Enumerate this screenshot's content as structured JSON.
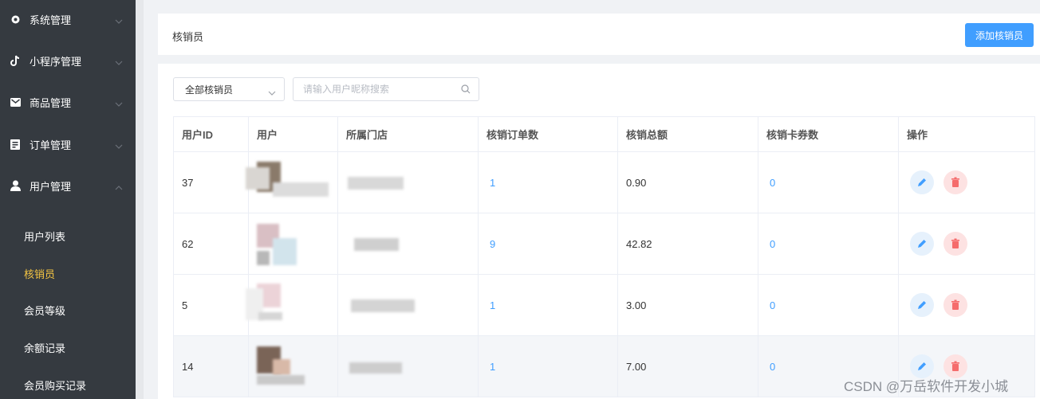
{
  "sidebar": {
    "menus": [
      {
        "label": "系统管理",
        "icon": "gear-icon"
      },
      {
        "label": "小程序管理",
        "icon": "tiktok-icon"
      },
      {
        "label": "商品管理",
        "icon": "mail-icon"
      },
      {
        "label": "订单管理",
        "icon": "order-icon"
      },
      {
        "label": "用户管理",
        "icon": "user-icon"
      }
    ],
    "sub_items": [
      {
        "label": "用户列表"
      },
      {
        "label": "核销员"
      },
      {
        "label": "会员等级"
      },
      {
        "label": "余额记录"
      },
      {
        "label": "会员购买记录"
      }
    ],
    "active_sub": "核销员"
  },
  "header": {
    "title": "核销员",
    "add_button": "添加核销员"
  },
  "filters": {
    "select_value": "全部核销员",
    "search_placeholder": "请输入用户昵称搜索"
  },
  "table": {
    "columns": [
      "用户ID",
      "用户",
      "所属门店",
      "核销订单数",
      "核销总额",
      "核销卡券数",
      "操作"
    ],
    "rows": [
      {
        "id": "37",
        "orders": "1",
        "total": "0.90",
        "coupons": "0"
      },
      {
        "id": "62",
        "orders": "9",
        "total": "42.82",
        "coupons": "0"
      },
      {
        "id": "5",
        "orders": "1",
        "total": "3.00",
        "coupons": "0"
      },
      {
        "id": "14",
        "orders": "1",
        "total": "7.00",
        "coupons": "0"
      }
    ]
  },
  "watermark": "CSDN @万岳软件开发小城",
  "colors": {
    "sidebar_bg": "#353a40",
    "accent": "#409eff",
    "active_text": "#f5c542",
    "delete": "#f56c6c"
  }
}
